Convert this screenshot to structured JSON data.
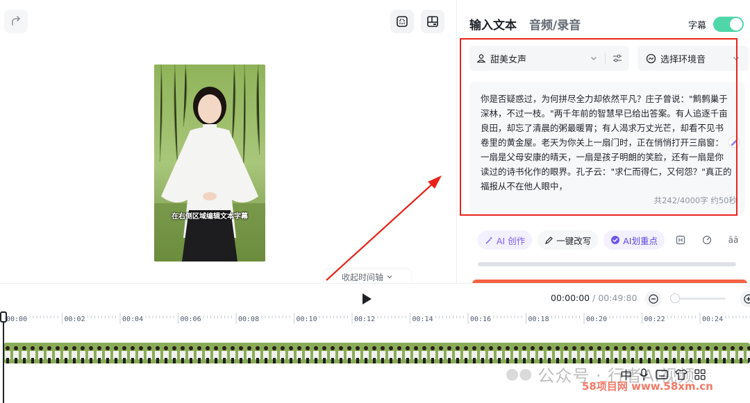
{
  "preview": {
    "subtitle_overlay": "在右侧区域编辑文本字幕",
    "collapse_timeline_label": "收起时间轴"
  },
  "panel": {
    "tabs": [
      {
        "label": "输入文本",
        "active": true
      },
      {
        "label": "音频/录音",
        "active": false
      }
    ],
    "subtitle_toggle": {
      "label": "字幕",
      "on": true
    },
    "voice": {
      "label": "甜美女声"
    },
    "ambient": {
      "label": "选择环境音"
    },
    "text": "你是否疑惑过，为何拼尽全力却依然平凡？庄子曾说：\"鹪鹩巢于深林，不过一枝。\"两千年前的智慧早已给出答案。有人追逐千亩良田，却忘了清晨的粥最暖胃；有人渴求万丈光芒，却看不见书卷里的黄金屋。老天为你关上一扇门时，正在悄悄打开三扇窗：一扇是父母安康的晴天，一扇是孩子明朗的笑脸，还有一扇是你读过的诗书化作的眼界。孔子云：\"求仁而得仁，又何怨？\"真正的福报从不在他人眼中，",
    "counter": "共242/4000字 约50秒",
    "actions": {
      "ai_create": "AI 创作",
      "rewrite": "一键改写",
      "highlight": "AI划重点",
      "extra": "āā"
    }
  },
  "timeline": {
    "current_time": "00:00:00",
    "separator": " / ",
    "total_time": "00:49:80",
    "ticks": [
      "00:00",
      "00:02",
      "00:04",
      "00:06",
      "00:08",
      "00:10",
      "00:12",
      "00:14",
      "00:16",
      "00:18",
      "00:20",
      "00:22",
      "00:24"
    ]
  },
  "overlays": {
    "watermark_account": "公众号 · 行者AI视频",
    "watermark_site": "58项目网 www.58xm.cn",
    "ime_char": "中"
  },
  "colors": {
    "accent_green": "#4fd6a8",
    "annotation_red": "#e8231b",
    "ai_purple": "#7b5cf5",
    "generate_orange": "#f56242"
  }
}
